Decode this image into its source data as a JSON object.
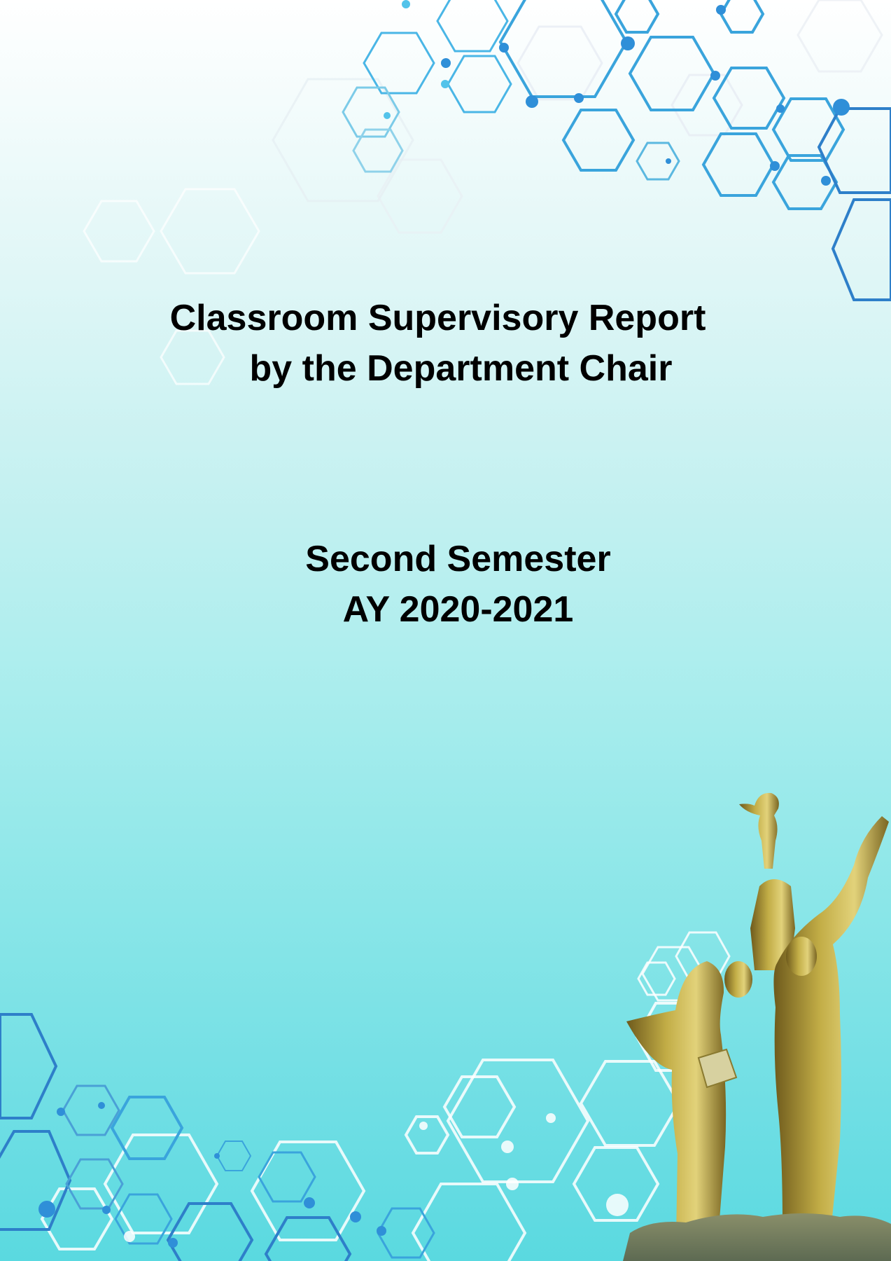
{
  "cover": {
    "title_line1": "Classroom Supervisory Report",
    "title_line2": "by the Department Chair",
    "semester_line1": "Second Semester",
    "semester_line2": "AY 2020-2021"
  },
  "decorations": {
    "hex_pattern_icon": "hexagon-network-icon",
    "statue_image": "golden-statue-monument-image",
    "colors": {
      "background_top": "#ffffff",
      "background_bottom": "#5ad9e0",
      "hex_blue": "#2f8fd8",
      "hex_light": "#ffffff",
      "statue_gold": "#b8a23a"
    }
  }
}
